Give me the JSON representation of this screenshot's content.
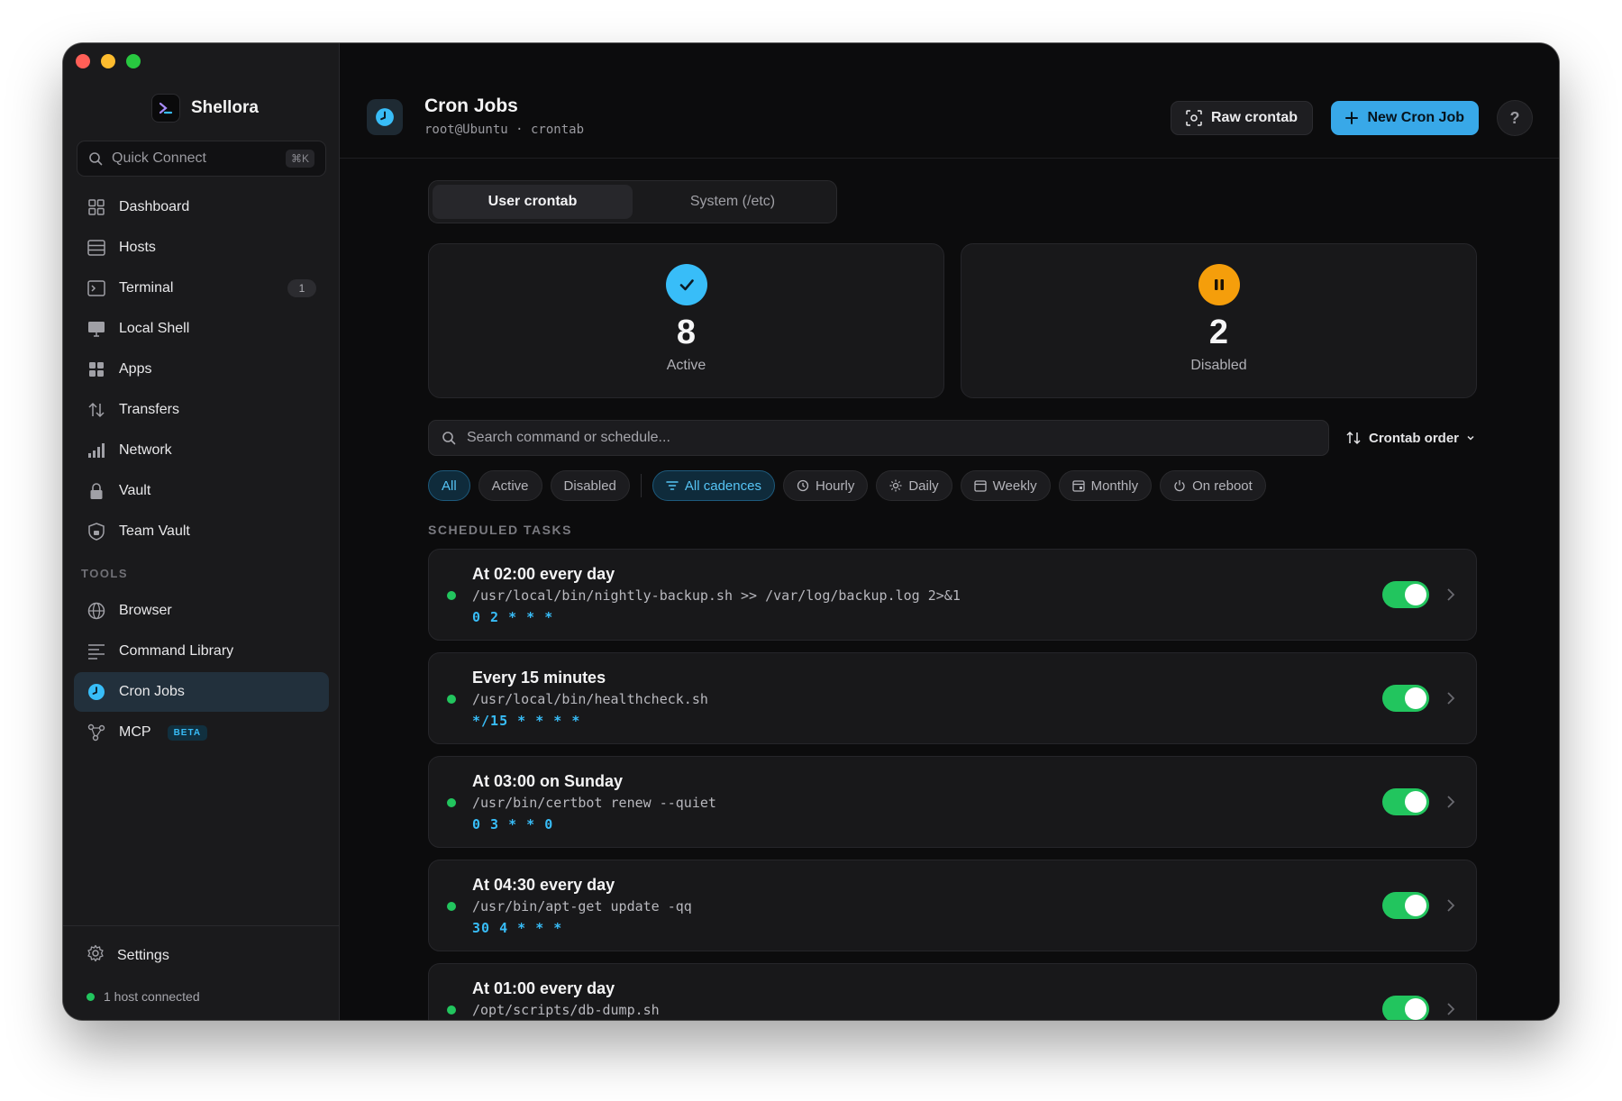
{
  "app": {
    "name": "Shellora"
  },
  "sidebar": {
    "quick_connect": {
      "placeholder": "Quick Connect",
      "shortcut": "⌘K"
    },
    "items": [
      {
        "label": "Dashboard",
        "icon": "grid-icon"
      },
      {
        "label": "Hosts",
        "icon": "server-icon"
      },
      {
        "label": "Terminal",
        "icon": "terminal-icon",
        "badge": "1"
      },
      {
        "label": "Local Shell",
        "icon": "monitor-icon"
      },
      {
        "label": "Apps",
        "icon": "apps-icon"
      },
      {
        "label": "Transfers",
        "icon": "transfer-arrows-icon"
      },
      {
        "label": "Network",
        "icon": "bar-signal-icon"
      },
      {
        "label": "Vault",
        "icon": "lock-icon"
      },
      {
        "label": "Team Vault",
        "icon": "shield-lock-icon"
      }
    ],
    "tools_label": "TOOLS",
    "tools": [
      {
        "label": "Browser",
        "icon": "globe-icon"
      },
      {
        "label": "Command Library",
        "icon": "list-icon"
      },
      {
        "label": "Cron Jobs",
        "icon": "clock-icon",
        "active": true
      },
      {
        "label": "MCP",
        "icon": "nodes-icon",
        "badge": "BETA"
      }
    ],
    "settings_label": "Settings",
    "status_text": "1 host connected"
  },
  "header": {
    "title": "Cron Jobs",
    "subtitle": "root@Ubuntu · crontab",
    "raw_button": "Raw crontab",
    "new_button": "New Cron Job",
    "help": "?"
  },
  "tabs": {
    "user": "User crontab",
    "system": "System (/etc)"
  },
  "stats": {
    "active": {
      "value": "8",
      "label": "Active"
    },
    "disabled": {
      "value": "2",
      "label": "Disabled"
    }
  },
  "search": {
    "placeholder": "Search command or schedule...",
    "sort_label": "Crontab order"
  },
  "filters": {
    "status": [
      "All",
      "Active",
      "Disabled"
    ],
    "cadences": [
      "All cadences",
      "Hourly",
      "Daily",
      "Weekly",
      "Monthly",
      "On reboot"
    ]
  },
  "section_title": "SCHEDULED TASKS",
  "tasks": [
    {
      "title": "At 02:00 every day",
      "command": "/usr/local/bin/nightly-backup.sh >> /var/log/backup.log 2>&1",
      "expr": "0 2 * * *",
      "enabled": true
    },
    {
      "title": "Every 15 minutes",
      "command": "/usr/local/bin/healthcheck.sh",
      "expr": "*/15 * * * *",
      "enabled": true
    },
    {
      "title": "At 03:00 on Sunday",
      "command": "/usr/bin/certbot renew --quiet",
      "expr": "0 3 * * 0",
      "enabled": true
    },
    {
      "title": "At 04:30 every day",
      "command": "/usr/bin/apt-get update -qq",
      "expr": "30 4 * * *",
      "enabled": true
    },
    {
      "title": "At 01:00 every day",
      "command": "/opt/scripts/db-dump.sh",
      "expr": "",
      "enabled": true
    }
  ],
  "colors": {
    "accent": "#38bdf8",
    "active_green": "#22c55e",
    "disabled_orange": "#f59e0b"
  }
}
